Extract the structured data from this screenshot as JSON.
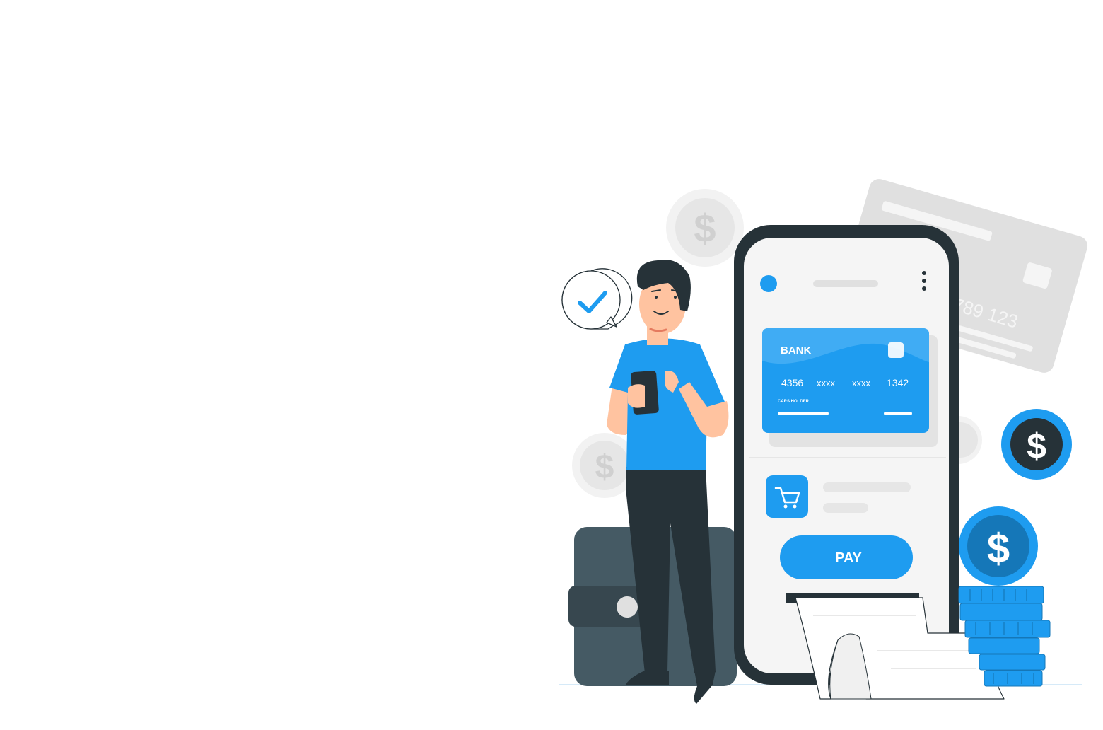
{
  "phone_card": {
    "bank": "BANK",
    "number_groups": [
      "4356",
      "xxxx",
      "xxxx",
      "1342"
    ],
    "holder_label": "CARS HOLDER"
  },
  "pay_button": {
    "label": "PAY"
  },
  "background_card": {
    "number": "789 123"
  },
  "coins": {
    "symbol": "$"
  },
  "colors": {
    "accent": "#1E9CF0",
    "dark": "#263238",
    "wallet": "#455A64",
    "light_gray": "#E0E0E0",
    "phone_screen": "#F5F5F5"
  },
  "icons": [
    "check-icon",
    "cart-icon",
    "more-vertical-icon",
    "dollar-coin-icon"
  ]
}
